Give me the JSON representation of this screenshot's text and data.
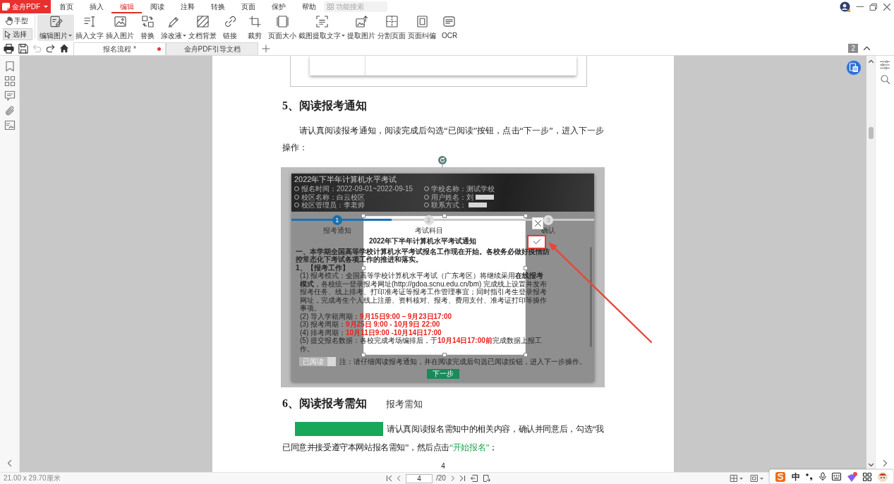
{
  "title_bar": {
    "logo_text": "金舟PDF",
    "menu_tabs": [
      {
        "label": "首页",
        "selected": false
      },
      {
        "label": "插入",
        "selected": false
      },
      {
        "label": "编辑",
        "selected": true
      },
      {
        "label": "阅读",
        "selected": false
      },
      {
        "label": "注释",
        "selected": false
      },
      {
        "label": "转换",
        "selected": false
      },
      {
        "label": "页面",
        "selected": false
      },
      {
        "label": "保护",
        "selected": false
      },
      {
        "label": "帮助",
        "selected": false
      }
    ],
    "search": {
      "placeholder": "功能搜索"
    }
  },
  "ribbon": {
    "modes": [
      {
        "kind": "hand",
        "label": "手型",
        "selected": false
      },
      {
        "kind": "select",
        "label": "选择",
        "selected": true
      }
    ],
    "tools": [
      {
        "kind": "edit-image",
        "label": "编辑图片",
        "dropdown": true,
        "selected": true
      },
      {
        "kind": "insert-text",
        "label": "插入文字",
        "dropdown": false,
        "selected": false
      },
      {
        "kind": "insert-image",
        "label": "插入图片",
        "dropdown": false,
        "selected": false
      },
      {
        "kind": "replace",
        "label": "替换",
        "dropdown": false,
        "selected": false
      },
      {
        "kind": "whiteout",
        "label": "涂改液",
        "dropdown": true,
        "selected": false
      },
      {
        "kind": "background",
        "label": "文档背景",
        "dropdown": false,
        "selected": false
      },
      {
        "kind": "link",
        "label": "链接",
        "dropdown": false,
        "selected": false
      },
      {
        "kind": "crop",
        "label": "裁剪",
        "dropdown": false,
        "selected": false
      },
      {
        "kind": "page-size",
        "label": "页面大小",
        "dropdown": false,
        "selected": false
      },
      {
        "kind": "screenshot-text",
        "label": "截图提取文字",
        "dropdown": true,
        "selected": false
      },
      {
        "kind": "extract-image",
        "label": "提取图片",
        "dropdown": false,
        "selected": false
      },
      {
        "kind": "split-page",
        "label": "分割页面",
        "dropdown": false,
        "selected": false
      },
      {
        "kind": "deskew",
        "label": "页面纠偏",
        "dropdown": false,
        "selected": false
      },
      {
        "kind": "ocr",
        "label": "OCR",
        "dropdown": false,
        "selected": false
      }
    ]
  },
  "quick_actions": [
    {
      "kind": "print",
      "disabled": false
    },
    {
      "kind": "save",
      "disabled": false
    },
    {
      "kind": "undo",
      "disabled": true
    },
    {
      "kind": "redo",
      "disabled": false
    },
    {
      "kind": "home",
      "disabled": false
    }
  ],
  "doc_tabs": [
    {
      "label": "报名流程 *",
      "selected": true,
      "modified": true
    },
    {
      "label": "金舟PDF引导文档",
      "selected": false,
      "modified": false
    }
  ],
  "page_badge": "2",
  "document": {
    "blocks": [
      {
        "kind": "image"
      },
      {
        "kind": "heading",
        "text": "5、阅读报考通知"
      },
      {
        "kind": "paragraph",
        "marker": false,
        "parts": [
          {
            "text": "请认真阅读报考通知，阅读完成后勾选“已阅读”按钮，点击“下一步”，进入下一步操作：",
            "highlight": false
          }
        ]
      },
      {
        "kind": "screenshot",
        "title": "2022年下半年计算机水平考试",
        "info": [
          {
            "text": "报名时间：2022-09-01~2022-09-15",
            "redacted": false
          },
          {
            "text": "学校名称：测试学校",
            "redacted": false
          },
          {
            "text": "校区名称：白云校区",
            "redacted": false
          },
          {
            "text": "用户姓名：刘",
            "redacted": true
          },
          {
            "text": "校区管理员：李老师",
            "redacted": false
          },
          {
            "text": "联系方式：",
            "redacted": true
          }
        ],
        "progress": {
          "level": 0.33
        },
        "steps": [
          {
            "number": "1",
            "label": "报考通知",
            "selected": true
          },
          {
            "number": "2",
            "label": "考试科目",
            "selected": false
          },
          {
            "number": "3",
            "label": "确认",
            "selected": false
          }
        ],
        "notice_title": "2022年下半年计算机水平考试通知",
        "notice_lines": [
          {
            "kind": "heading",
            "parts": [
              {
                "text": "一、本学期全国高等学校计算机水平考试报名工作现在开始。各校务必做好疫情防控常态化下考试各项工作的推进和落实。",
                "highlight": false
              }
            ]
          },
          {
            "kind": "heading",
            "parts": [
              {
                "text": "1、【报考工作】",
                "highlight": false
              }
            ]
          },
          {
            "kind": "item",
            "parts": [
              {
                "text": "(1) 报考模式：全国高等学校计算机水平考试（广东考区）将继续采用**在线报考模式**，各校统一登录报考网址(http://gdoa.scnu.edu.cn/bm) 完成线上设置并发布报考任务、线上排考、打印准考证等报考工作管理事宜；同时指引考生登录报考网址，完成考生个人线上注册、资料核对、报考、费用支付、准考证打印等操作事项。",
                "highlight": false
              }
            ]
          },
          {
            "kind": "item",
            "parts": [
              {
                "text": "(2) 导入学籍周期：",
                "highlight": false
              },
              {
                "text": "9月15日9:00 – 9月23日17:00",
                "highlight": true
              }
            ]
          },
          {
            "kind": "item",
            "parts": [
              {
                "text": "(3) 报考周期：",
                "highlight": false
              },
              {
                "text": "9月25日 9:00 - 10月9日 22:00",
                "highlight": true
              }
            ]
          },
          {
            "kind": "item",
            "parts": [
              {
                "text": "(4) 排考周期：",
                "highlight": false
              },
              {
                "text": "10月11日9:00 -10月14日17:00",
                "highlight": true
              }
            ]
          },
          {
            "kind": "item",
            "parts": [
              {
                "text": "(5) 提交报名数据：各校完成考场编排后，于",
                "highlight": false
              },
              {
                "text": "10月14日17:00前",
                "highlight": true
              },
              {
                "text": "完成数据上报工作。",
                "highlight": false
              }
            ]
          }
        ],
        "read_button": {
          "label": "已阅读",
          "disabled": true
        },
        "note": "注：请仔细阅读报考通知，并在阅读完成后勾选已阅读按钮，进入下一步操作。",
        "next_button": "下一步"
      },
      {
        "kind": "heading",
        "text": "6、阅读报考需知",
        "aside": "报考需知"
      },
      {
        "kind": "paragraph",
        "marker": true,
        "parts": [
          {
            "text": "请认真阅读报名需知中的相关内容，确认并同意后，勾选“我已同意并接受遵守本网站报名需知”，然后点击",
            "highlight": false
          },
          {
            "text": "“开始报名”",
            "highlight": true
          },
          {
            "text": "；",
            "highlight": false
          }
        ]
      }
    ],
    "page_number": "4"
  },
  "status_bar": {
    "page_size": "21.00 x 29.70厘米",
    "page_input": "4",
    "page_total": "/20"
  },
  "ime_bar": {
    "mode": "中"
  }
}
